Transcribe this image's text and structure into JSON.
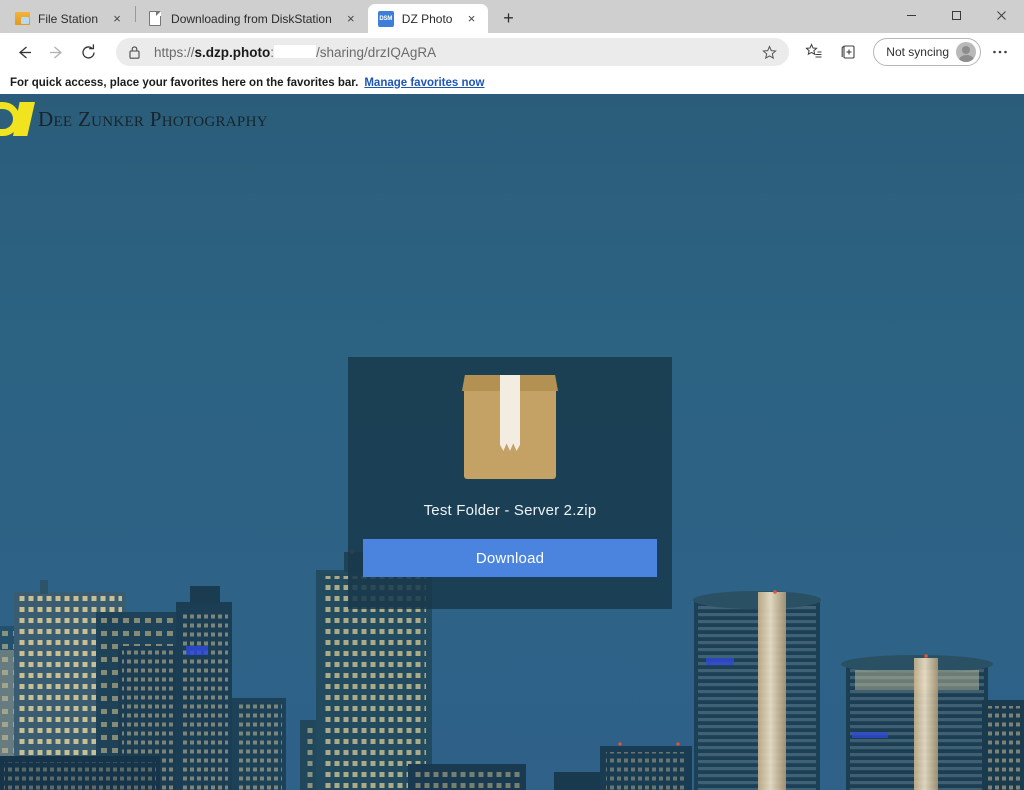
{
  "window": {
    "controls": [
      {
        "name": "minimize",
        "glyph": "–"
      },
      {
        "name": "maximize",
        "glyph": "□"
      },
      {
        "name": "close",
        "glyph": "×"
      }
    ]
  },
  "tabs": [
    {
      "title": "File Station",
      "favicon": "file-station-folder-icon",
      "active": false,
      "close_label": "×"
    },
    {
      "title": "Downloading from DiskStation",
      "favicon": "generic-page-icon",
      "active": false,
      "close_label": "×"
    },
    {
      "title": "DZ Photo",
      "favicon": "dsm-icon",
      "favicon_text": "DSM",
      "active": true,
      "close_label": "×"
    }
  ],
  "new_tab_label": "+",
  "toolbar": {
    "back_label": "←",
    "forward_label": "→",
    "reload_label": "⟳",
    "lock_icon": "lock-icon",
    "url": {
      "scheme": "https://",
      "host": "s.dzp.photo",
      "colon": ":",
      "redacted_port": "",
      "path": "/sharing/drzIQAgRA",
      "full": "https://s.dzp.photo:/sharing/drzIQAgRA"
    },
    "favorite_star_label": "☆",
    "collections_icon": "collections-icon",
    "split_screen_icon": "split-screen-icon",
    "profile_label": "Not syncing",
    "settings_more_label": "···"
  },
  "favorites_bar": {
    "message": "For quick access, place your favorites here on the favorites bar.",
    "link_label": "Manage favorites now"
  },
  "page": {
    "logo": {
      "monogram": "DZ",
      "wordmark": "Dee Zunker Photography"
    },
    "card": {
      "icon": "cardboard-box-icon",
      "filename": "Test Folder - Server 2.zip",
      "download_label": "Download"
    },
    "background": {
      "description": "city skyline at dusk",
      "sky_top_color": "#2b5d7a",
      "sky_bottom_color": "#2f6189"
    }
  },
  "colors": {
    "accent_blue": "#4a84de",
    "card_bg": "#18394c",
    "logo_yellow": "#f2e31f",
    "link_blue": "#1f55b5",
    "tab_active_bg": "#ffffff",
    "titlebar_bg": "#cfcfcf"
  }
}
